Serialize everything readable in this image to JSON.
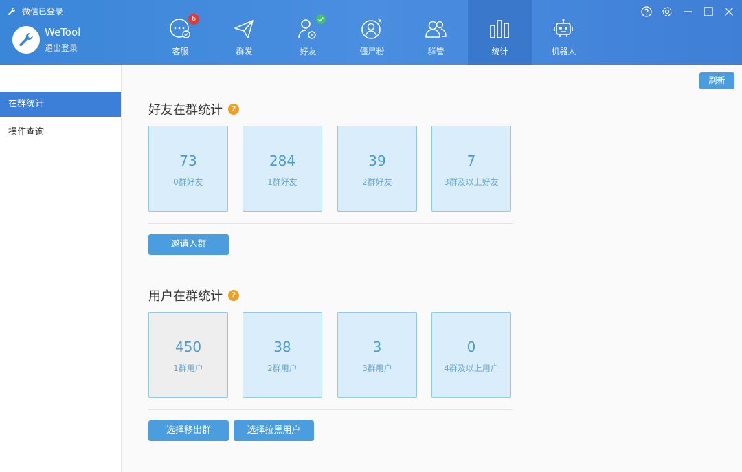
{
  "app": {
    "title": "微信已登录",
    "user_name": "WeTool",
    "logout_label": "退出登录"
  },
  "nav": [
    {
      "label": "客服",
      "badge": "6"
    },
    {
      "label": "群发"
    },
    {
      "label": "好友"
    },
    {
      "label": "僵尸粉"
    },
    {
      "label": "群管"
    },
    {
      "label": "统计"
    },
    {
      "label": "机器人"
    }
  ],
  "sidebar": {
    "items": [
      {
        "label": "在群统计"
      },
      {
        "label": "操作查询"
      }
    ]
  },
  "main": {
    "refresh_label": "刷新",
    "friends_section": {
      "title": "好友在群统计",
      "help": "?",
      "cards": [
        {
          "value": "73",
          "caption": "0群好友"
        },
        {
          "value": "284",
          "caption": "1群好友"
        },
        {
          "value": "39",
          "caption": "2群好友"
        },
        {
          "value": "7",
          "caption": "3群及以上好友"
        }
      ],
      "invite_button": "邀请入群"
    },
    "users_section": {
      "title": "用户在群统计",
      "help": "?",
      "cards": [
        {
          "value": "450",
          "caption": "1群用户"
        },
        {
          "value": "38",
          "caption": "2群用户"
        },
        {
          "value": "3",
          "caption": "3群用户"
        },
        {
          "value": "0",
          "caption": "4群及以上用户"
        }
      ],
      "remove_button": "选择移出群",
      "blacklist_button": "选择拉黑用户"
    }
  },
  "colors": {
    "topbar": "#3f86db",
    "accent": "#4a9ee0",
    "active_nav": "#3a78cb",
    "card_bg": "#d9eefa",
    "badge": "#e53935",
    "help": "#f0a020"
  }
}
